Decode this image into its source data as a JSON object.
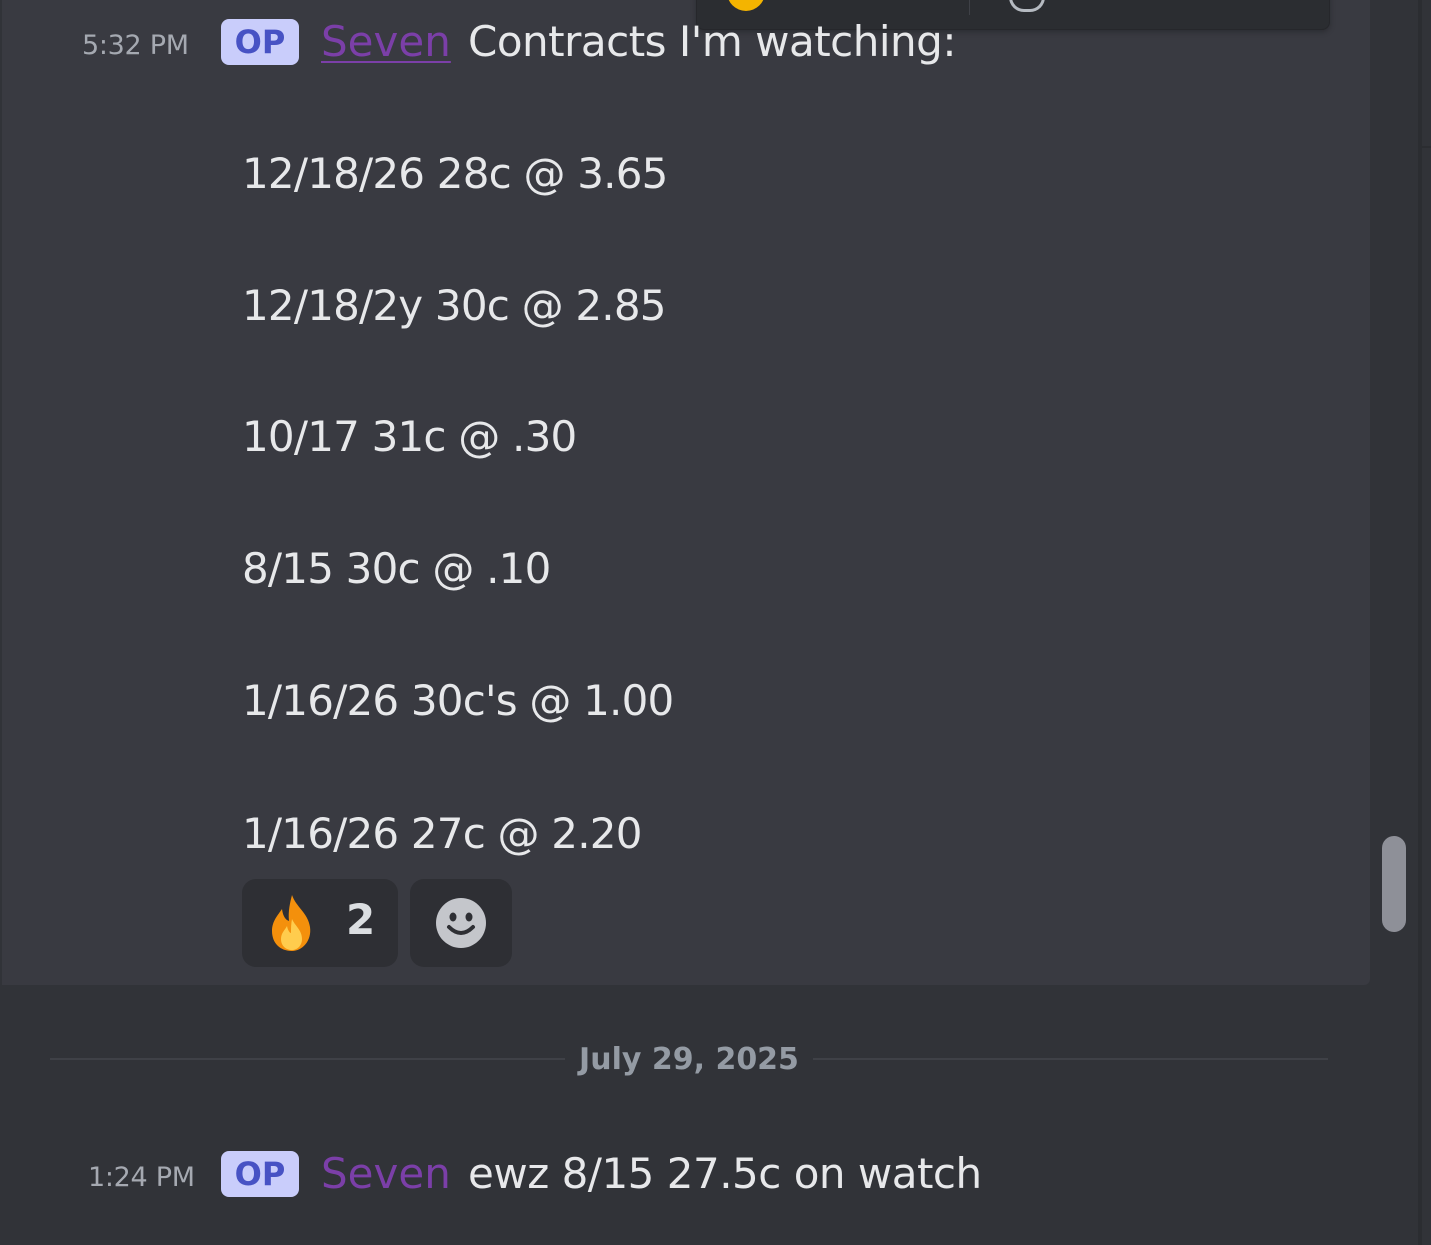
{
  "messages": [
    {
      "timestamp": "5:32 PM",
      "badge": "OP",
      "author": "Seven",
      "text": "Contracts I'm watching:",
      "lines": [
        "12/18/26 28c @ 3.65",
        "12/18/2y 30c @ 2.85",
        "10/17 31c @ .30",
        "8/15 30c @ .10",
        "1/16/26 30c's @ 1.00",
        "1/16/26 27c @ 2.20"
      ],
      "reactions": [
        {
          "icon": "fire-icon",
          "count": "2"
        }
      ]
    },
    {
      "timestamp": "1:24 PM",
      "badge": "OP",
      "author": "Seven",
      "text": "ewz 8/15 27.5c on watch"
    }
  ],
  "date_divider": "July 29, 2025",
  "colors": {
    "background": "#313338",
    "hover_background": "#393a41",
    "author": "#7b3fa8",
    "badge_bg": "#c9cdfb",
    "badge_text": "#4752c4"
  }
}
